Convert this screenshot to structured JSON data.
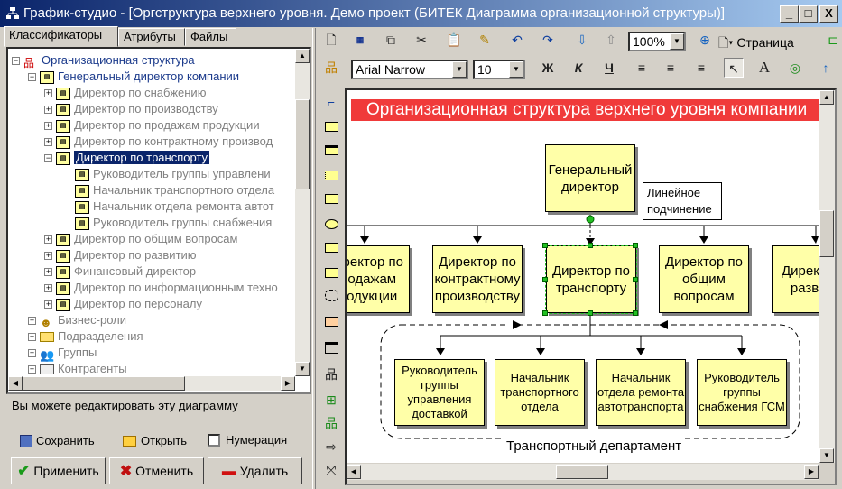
{
  "window": {
    "title": "График-студио - [Оргструктура верхнего уровня. Демо проект (БИТЕК Диаграмма организационной структуры)]",
    "min_label": "_",
    "max_label": "□",
    "close_label": "X"
  },
  "tabs": [
    "Классификаторы",
    "Атрибуты",
    "Файлы"
  ],
  "tree": {
    "root": "Организационная структура",
    "ceo": "Генеральный директор компании",
    "items": [
      "Директор по снабжению",
      "Директор по производству",
      "Директор по продажам продукции",
      "Директор по контрактному производ",
      "Директор по транспорту",
      "Руководитель группы управлени",
      "Начальник транспортного отдела",
      "Начальник отдела ремонта автот",
      "Руководитель группы снабжения",
      "Директор по общим вопросам",
      "Директор по развитию",
      "Финансовый директор",
      "Директор по информационным техно",
      "Директор по персоналу"
    ],
    "groups": [
      "Бизнес-роли",
      "Подразделения",
      "Группы",
      "Контрагенты"
    ]
  },
  "left_panel": {
    "info": "Вы можете редактировать эту диаграмму",
    "save": "Сохранить",
    "open": "Открыть",
    "numbering": "Нумерация",
    "apply": "Применить",
    "cancel": "Отменить",
    "delete": "Удалить"
  },
  "toolbar": {
    "zoom": "100%",
    "page": "Страница",
    "font": "Arial Narrow",
    "size": "10",
    "bold": "Ж",
    "italic": "К",
    "underline": "Ч",
    "text_tool": "A"
  },
  "diagram": {
    "title": "Организационная структура верхнего уровня компании",
    "ceo": "Генеральный директор",
    "note": "Линейное подчинение",
    "directors": [
      "Директор по продажам продукции",
      "Директор по контрактному производству",
      "Директор по транспорту",
      "Директор по общим вопросам",
      "Директор по развитию"
    ],
    "subordinates": [
      "Руководитель группы управления доставкой",
      "Начальник транспортного отдела",
      "Начальник отдела ремонта автотранспорта",
      "Руководитель группы снабжения ГСМ"
    ],
    "dept_label": "Транспортный департамент"
  },
  "colors": {
    "title_bar": "#0a246a",
    "diagram_header": "#f03a3a",
    "node_fill": "#ffffa8",
    "selection": "#22c022"
  }
}
